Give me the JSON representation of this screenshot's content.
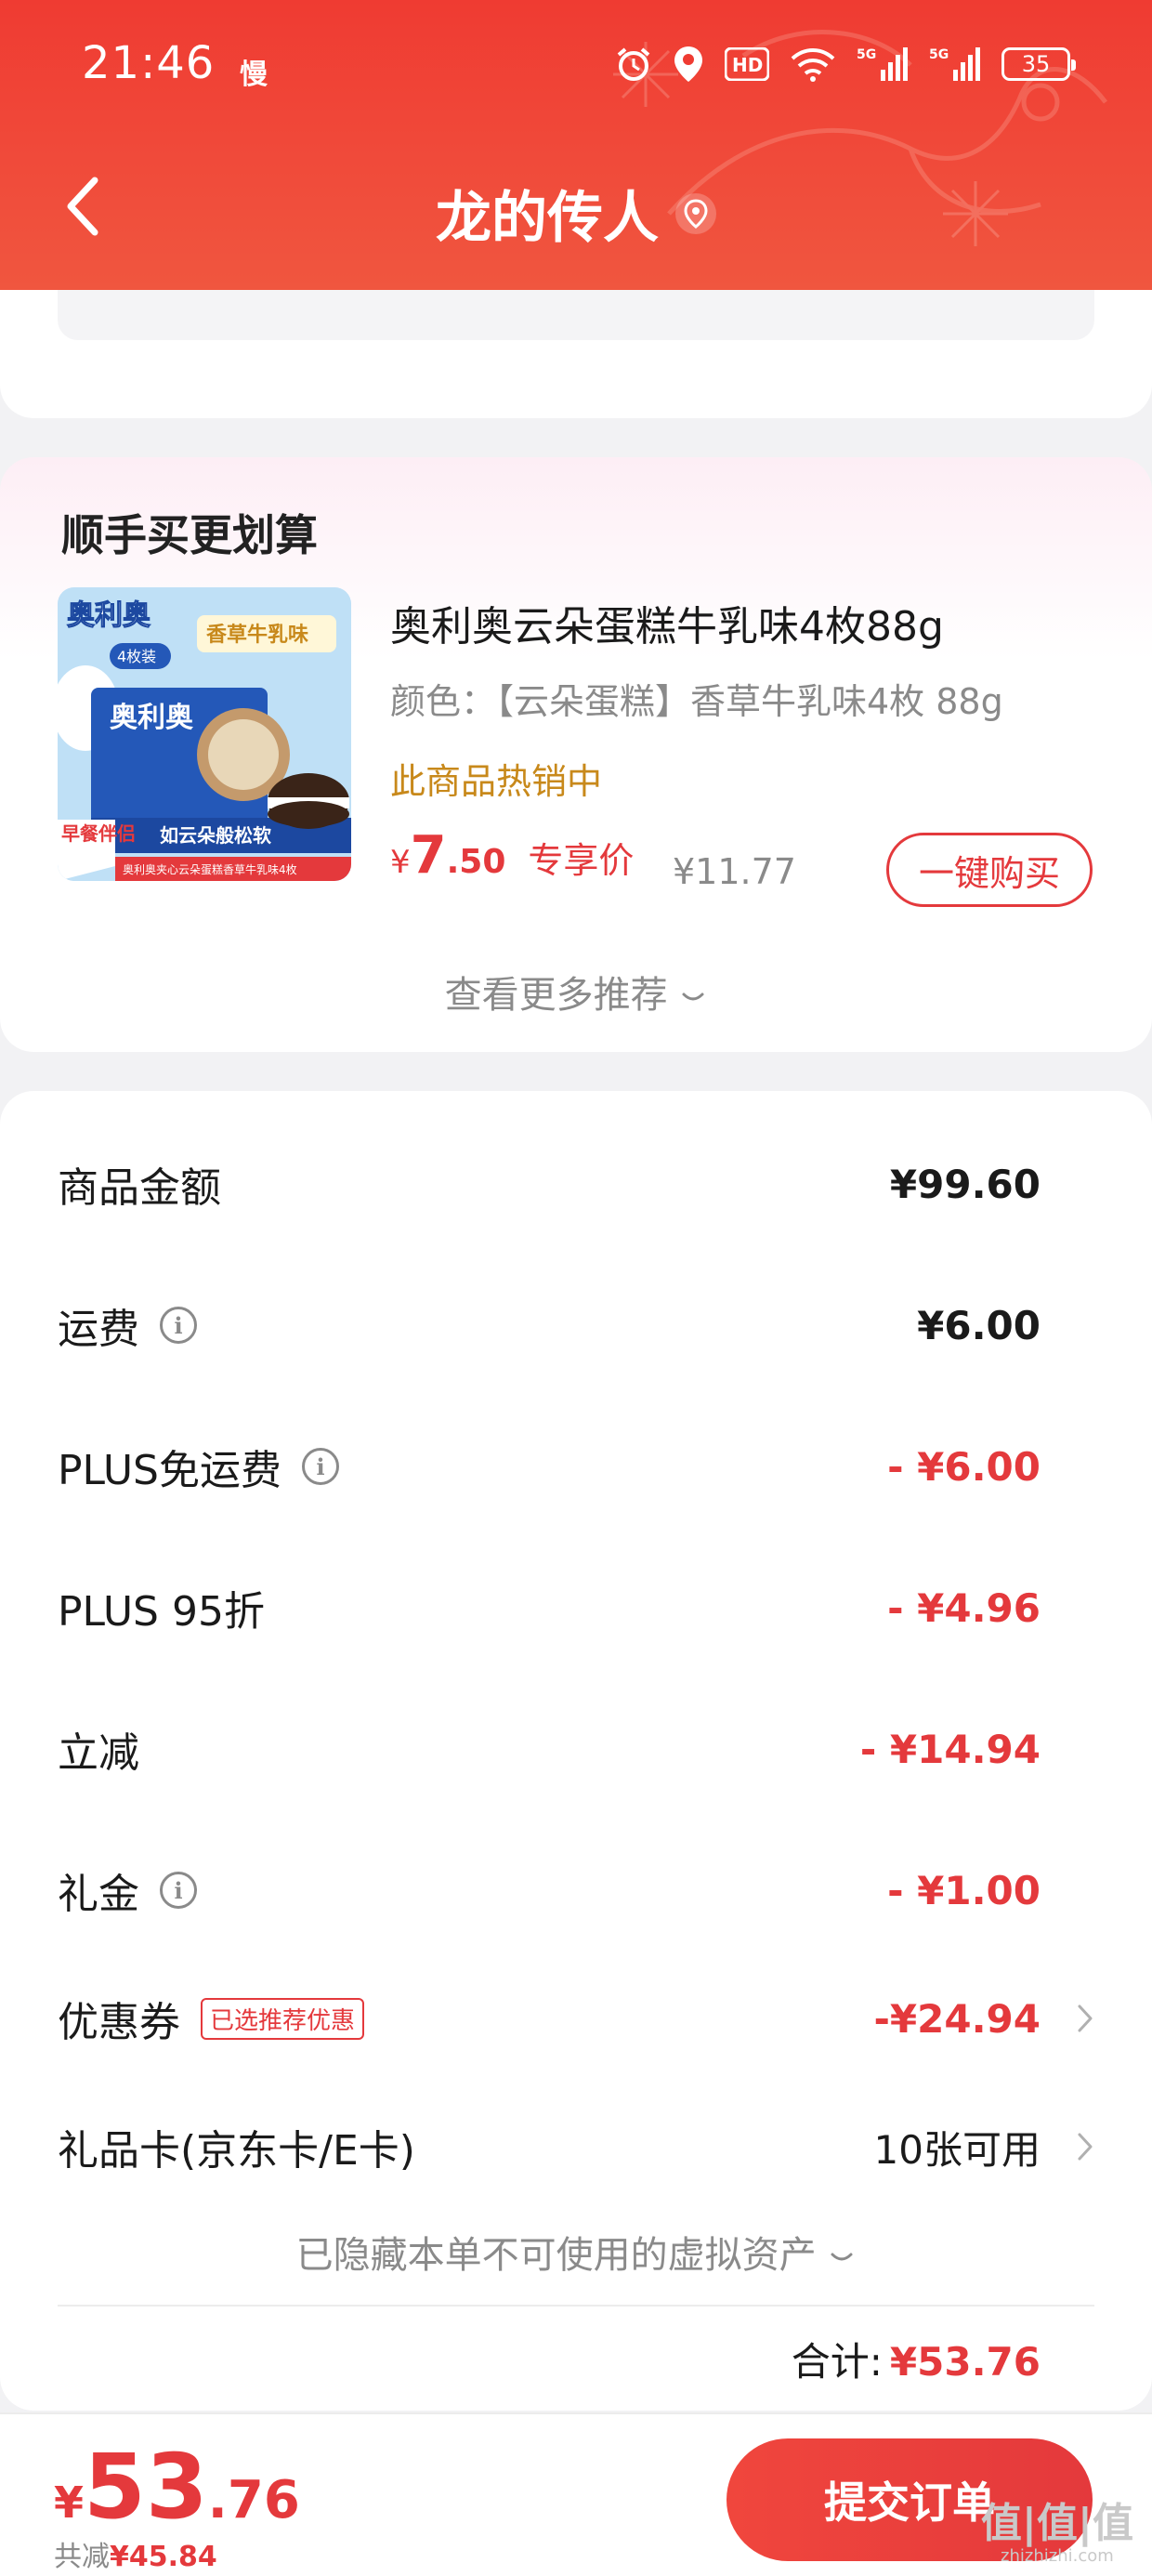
{
  "status_bar": {
    "time": "21:46",
    "slow_indicator": "慢",
    "battery": "35",
    "icons": [
      "alarm-icon",
      "location-icon",
      "hd-icon",
      "wifi-icon",
      "signal-5g-icon",
      "signal-5g-icon",
      "battery-icon"
    ]
  },
  "header": {
    "title": "龙的传人",
    "accent_color": "#ef3b32"
  },
  "recommend": {
    "title": "顺手买更划算",
    "product": {
      "name": "奥利奥云朵蛋糕牛乳味4枚88g",
      "spec": "颜色：【云朵蛋糕】香草牛乳味4枚 88g",
      "hot_label": "此商品热销中",
      "price_symbol": "¥",
      "price_int": "7",
      "price_dec": ".50",
      "price_tag": "专享价",
      "original_price": "¥11.77",
      "buy_label": "一键购买",
      "image_texts": {
        "brand": "奥利奥",
        "flavor": "香草牛乳味",
        "count": "4枚装",
        "breakfast": "早餐伴侣",
        "slogan": "如云朵般松软",
        "sub": "奥利奥夹心云朵蛋糕香草牛乳味4枚"
      }
    },
    "more_label": "查看更多推荐"
  },
  "summary": {
    "rows": [
      {
        "label": "商品金额",
        "value": "¥99.60"
      },
      {
        "label": "运费",
        "value": "¥6.00"
      },
      {
        "label": "PLUS免运费",
        "value": "- ¥6.00"
      },
      {
        "label": "PLUS 95折",
        "value": "- ¥4.96"
      },
      {
        "label": "立减",
        "value": "- ¥14.94"
      },
      {
        "label": "礼金",
        "value": "- ¥1.00"
      },
      {
        "label": "优惠券",
        "badge": "已选推荐优惠",
        "value": "-¥24.94"
      },
      {
        "label": "礼品卡(京东卡/E卡)",
        "value": "10张可用"
      }
    ],
    "hidden_assets_label": "已隐藏本单不可使用的虚拟资产",
    "total_label": "合计:",
    "total_value": "¥53.76"
  },
  "bottom_bar": {
    "price_symbol": "¥",
    "price_int": "53",
    "price_dec": ".76",
    "save_label": "共减",
    "save_value": "¥45.84",
    "submit_label": "提交订单",
    "watermark": "值|值|值",
    "watermark_url": "zhizhizhi.com"
  }
}
